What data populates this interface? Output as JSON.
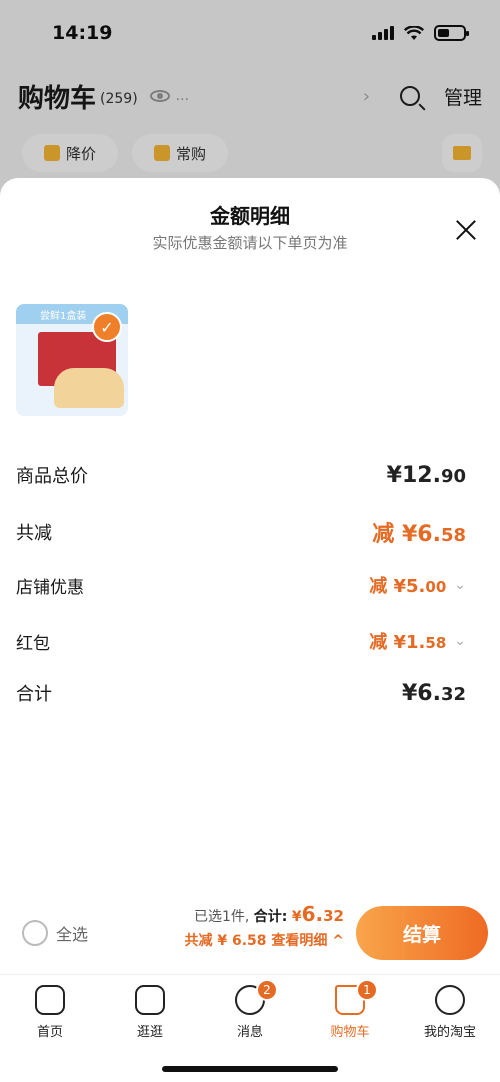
{
  "status": {
    "time": "14:19"
  },
  "cart_header": {
    "title": "购物车",
    "count": "(259)",
    "ellipsis": "...",
    "manage": "管理"
  },
  "chips": [
    {
      "label": "降价"
    },
    {
      "label": "常购"
    }
  ],
  "sheet": {
    "title": "金额明细",
    "subtitle": "实际优惠金额请以下单页为准",
    "product": {
      "banner": "尝鲜1盒装"
    },
    "rows": [
      {
        "label": "商品总价",
        "prefix": "",
        "currency": "¥",
        "int": "12.",
        "dec": "90"
      },
      {
        "label": "共减",
        "prefix": "减 ",
        "currency": "¥",
        "int": "6.",
        "dec": "58"
      },
      {
        "label": "店铺优惠",
        "prefix": "减 ",
        "currency": "¥",
        "int": "5.",
        "dec": "00"
      },
      {
        "label": "红包",
        "prefix": "减 ",
        "currency": "¥",
        "int": "1.",
        "dec": "58"
      },
      {
        "label": "合计",
        "prefix": "",
        "currency": "¥",
        "int": "6.",
        "dec": "32"
      }
    ]
  },
  "bottom_bar": {
    "select_all": "全选",
    "selected_text": "已选1件,",
    "total_label": "合计:",
    "total_currency": "¥",
    "total_int": "6.",
    "total_dec": "32",
    "discount_text": "共减 ¥ 6.58",
    "detail_link": "查看明细 ^",
    "checkout": "结算"
  },
  "tabs": [
    {
      "label": "首页",
      "badge": ""
    },
    {
      "label": "逛逛",
      "badge": ""
    },
    {
      "label": "消息",
      "badge": "2"
    },
    {
      "label": "购物车",
      "badge": "1"
    },
    {
      "label": "我的淘宝",
      "badge": ""
    }
  ],
  "colors": {
    "accent": "#e56b25",
    "checkout_start": "#f8a54b",
    "checkout_end": "#ef6a24"
  }
}
